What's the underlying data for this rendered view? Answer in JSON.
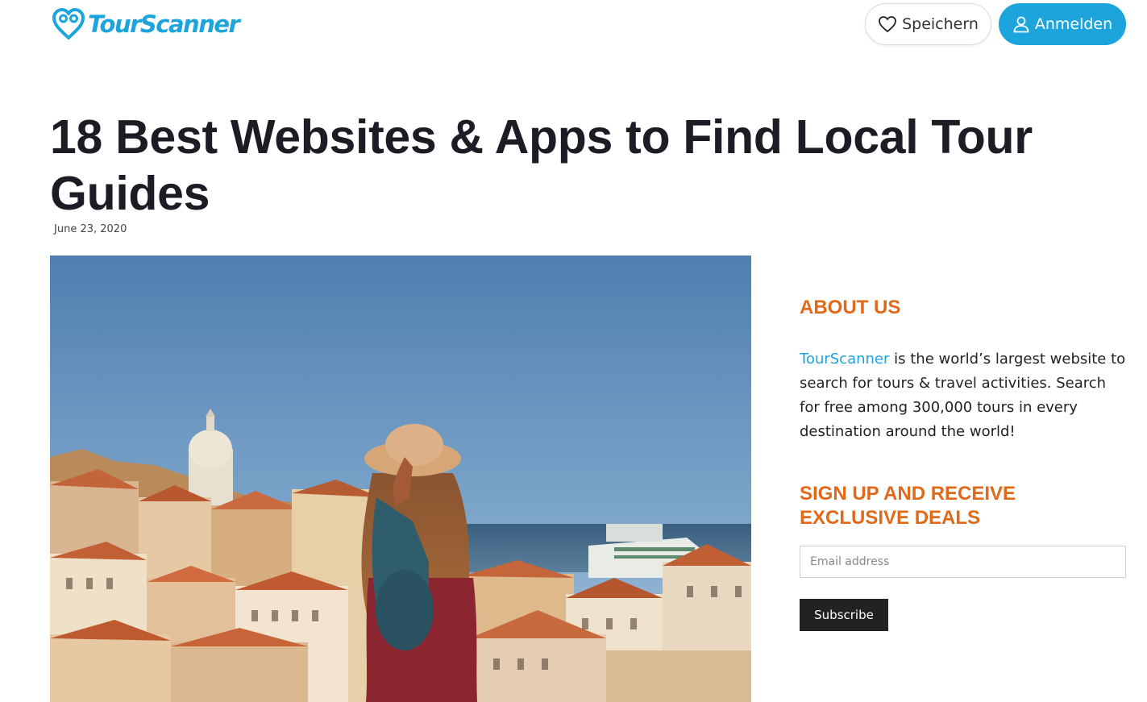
{
  "header": {
    "brand": "TourScanner",
    "save_label": "Speichern",
    "login_label": "Anmelden",
    "colors": {
      "brand_blue": "#1ba5dc"
    }
  },
  "article": {
    "title": "18 Best Websites & Apps to Find Local Tour Guides",
    "date": "June 23, 2020",
    "hero_image": "woman-in-sun-hat-overlooking-lisbon-rooftops"
  },
  "sidebar": {
    "about": {
      "heading": "ABOUT US",
      "brand_link": "TourScanner",
      "text": " is the world’s largest website to search for tours & travel activities. Search for free among 300,000 tours in every destination around the world!"
    },
    "signup": {
      "heading": "SIGN UP AND RECEIVE EXCLUSIVE DEALS",
      "email_placeholder": "Email address",
      "subscribe_label": "Subscribe"
    },
    "colors": {
      "heading": "#e0691a",
      "button": "#222222"
    }
  }
}
